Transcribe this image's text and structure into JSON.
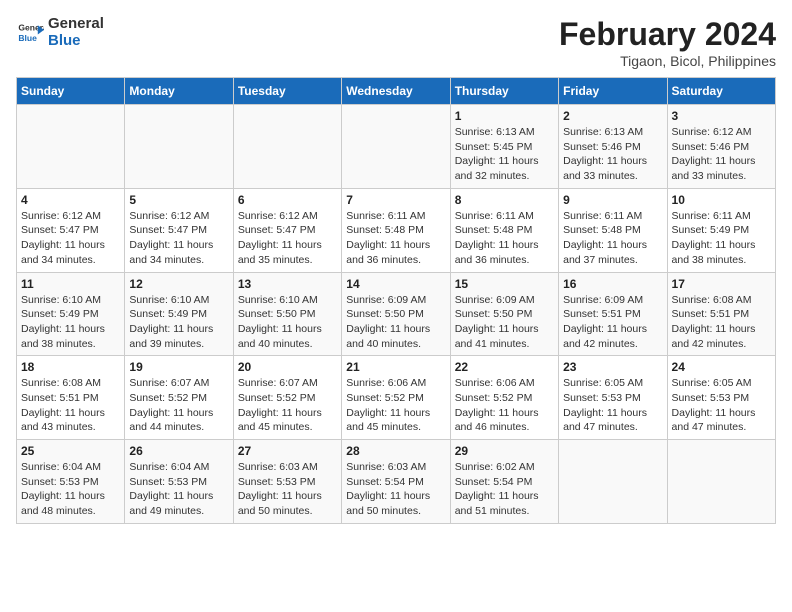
{
  "header": {
    "logo_line1": "General",
    "logo_line2": "Blue",
    "month_year": "February 2024",
    "location": "Tigaon, Bicol, Philippines"
  },
  "days_of_week": [
    "Sunday",
    "Monday",
    "Tuesday",
    "Wednesday",
    "Thursday",
    "Friday",
    "Saturday"
  ],
  "weeks": [
    [
      {
        "day": "",
        "info": ""
      },
      {
        "day": "",
        "info": ""
      },
      {
        "day": "",
        "info": ""
      },
      {
        "day": "",
        "info": ""
      },
      {
        "day": "1",
        "info": "Sunrise: 6:13 AM\nSunset: 5:45 PM\nDaylight: 11 hours and 32 minutes."
      },
      {
        "day": "2",
        "info": "Sunrise: 6:13 AM\nSunset: 5:46 PM\nDaylight: 11 hours and 33 minutes."
      },
      {
        "day": "3",
        "info": "Sunrise: 6:12 AM\nSunset: 5:46 PM\nDaylight: 11 hours and 33 minutes."
      }
    ],
    [
      {
        "day": "4",
        "info": "Sunrise: 6:12 AM\nSunset: 5:47 PM\nDaylight: 11 hours and 34 minutes."
      },
      {
        "day": "5",
        "info": "Sunrise: 6:12 AM\nSunset: 5:47 PM\nDaylight: 11 hours and 34 minutes."
      },
      {
        "day": "6",
        "info": "Sunrise: 6:12 AM\nSunset: 5:47 PM\nDaylight: 11 hours and 35 minutes."
      },
      {
        "day": "7",
        "info": "Sunrise: 6:11 AM\nSunset: 5:48 PM\nDaylight: 11 hours and 36 minutes."
      },
      {
        "day": "8",
        "info": "Sunrise: 6:11 AM\nSunset: 5:48 PM\nDaylight: 11 hours and 36 minutes."
      },
      {
        "day": "9",
        "info": "Sunrise: 6:11 AM\nSunset: 5:48 PM\nDaylight: 11 hours and 37 minutes."
      },
      {
        "day": "10",
        "info": "Sunrise: 6:11 AM\nSunset: 5:49 PM\nDaylight: 11 hours and 38 minutes."
      }
    ],
    [
      {
        "day": "11",
        "info": "Sunrise: 6:10 AM\nSunset: 5:49 PM\nDaylight: 11 hours and 38 minutes."
      },
      {
        "day": "12",
        "info": "Sunrise: 6:10 AM\nSunset: 5:49 PM\nDaylight: 11 hours and 39 minutes."
      },
      {
        "day": "13",
        "info": "Sunrise: 6:10 AM\nSunset: 5:50 PM\nDaylight: 11 hours and 40 minutes."
      },
      {
        "day": "14",
        "info": "Sunrise: 6:09 AM\nSunset: 5:50 PM\nDaylight: 11 hours and 40 minutes."
      },
      {
        "day": "15",
        "info": "Sunrise: 6:09 AM\nSunset: 5:50 PM\nDaylight: 11 hours and 41 minutes."
      },
      {
        "day": "16",
        "info": "Sunrise: 6:09 AM\nSunset: 5:51 PM\nDaylight: 11 hours and 42 minutes."
      },
      {
        "day": "17",
        "info": "Sunrise: 6:08 AM\nSunset: 5:51 PM\nDaylight: 11 hours and 42 minutes."
      }
    ],
    [
      {
        "day": "18",
        "info": "Sunrise: 6:08 AM\nSunset: 5:51 PM\nDaylight: 11 hours and 43 minutes."
      },
      {
        "day": "19",
        "info": "Sunrise: 6:07 AM\nSunset: 5:52 PM\nDaylight: 11 hours and 44 minutes."
      },
      {
        "day": "20",
        "info": "Sunrise: 6:07 AM\nSunset: 5:52 PM\nDaylight: 11 hours and 45 minutes."
      },
      {
        "day": "21",
        "info": "Sunrise: 6:06 AM\nSunset: 5:52 PM\nDaylight: 11 hours and 45 minutes."
      },
      {
        "day": "22",
        "info": "Sunrise: 6:06 AM\nSunset: 5:52 PM\nDaylight: 11 hours and 46 minutes."
      },
      {
        "day": "23",
        "info": "Sunrise: 6:05 AM\nSunset: 5:53 PM\nDaylight: 11 hours and 47 minutes."
      },
      {
        "day": "24",
        "info": "Sunrise: 6:05 AM\nSunset: 5:53 PM\nDaylight: 11 hours and 47 minutes."
      }
    ],
    [
      {
        "day": "25",
        "info": "Sunrise: 6:04 AM\nSunset: 5:53 PM\nDaylight: 11 hours and 48 minutes."
      },
      {
        "day": "26",
        "info": "Sunrise: 6:04 AM\nSunset: 5:53 PM\nDaylight: 11 hours and 49 minutes."
      },
      {
        "day": "27",
        "info": "Sunrise: 6:03 AM\nSunset: 5:53 PM\nDaylight: 11 hours and 50 minutes."
      },
      {
        "day": "28",
        "info": "Sunrise: 6:03 AM\nSunset: 5:54 PM\nDaylight: 11 hours and 50 minutes."
      },
      {
        "day": "29",
        "info": "Sunrise: 6:02 AM\nSunset: 5:54 PM\nDaylight: 11 hours and 51 minutes."
      },
      {
        "day": "",
        "info": ""
      },
      {
        "day": "",
        "info": ""
      }
    ]
  ]
}
